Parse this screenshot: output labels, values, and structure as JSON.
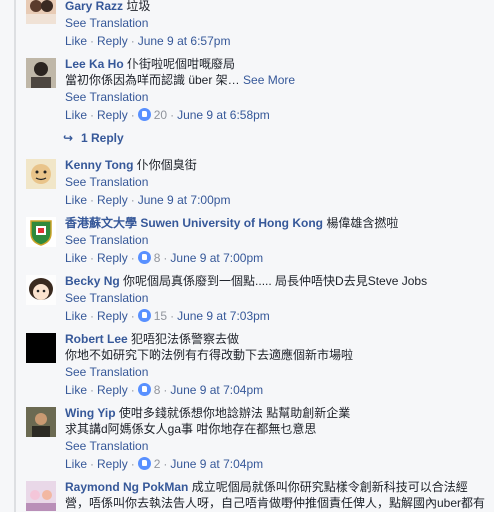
{
  "comments": [
    {
      "name": "Gary Razz",
      "text": "垃圾",
      "see_translation": "See Translation",
      "like": "Like",
      "reply": "Reply",
      "time": "June 9 at 6:57pm"
    },
    {
      "name": "Lee Ka Ho",
      "text": "仆街啦呢個咁嘅廢局",
      "text2": "當初你係因為咩而認識 über 架…",
      "see_more": "See More",
      "see_translation": "See Translation",
      "like": "Like",
      "reply": "Reply",
      "likes": "20",
      "time": "June 9 at 6:58pm"
    },
    {
      "name": "Kenny Tong",
      "text": "仆你個臭街",
      "see_translation": "See Translation",
      "like": "Like",
      "reply": "Reply",
      "time": "June 9 at 7:00pm"
    },
    {
      "name": "香港蘇文大學 Suwen University of Hong Kong",
      "text": "楊偉雄含撚啦",
      "see_translation": "See Translation",
      "like": "Like",
      "reply": "Reply",
      "likes": "8",
      "time": "June 9 at 7:00pm"
    },
    {
      "name": "Becky Ng",
      "text": "你呢個局真係廢到一個點..... 局長仲唔快D去見Steve Jobs",
      "see_translation": "See Translation",
      "like": "Like",
      "reply": "Reply",
      "likes": "15",
      "time": "June 9 at 7:03pm"
    },
    {
      "name": "Robert Lee",
      "text": "犯唔犯法係警察去做",
      "text2": "你地不如研究下啲法例有冇得改動下去適應個新市場啦",
      "see_translation": "See Translation",
      "like": "Like",
      "reply": "Reply",
      "likes": "8",
      "time": "June 9 at 7:04pm"
    },
    {
      "name": "Wing Yip",
      "text": "使咁多錢就係想你地諗辦法 點幫助創新企業",
      "text2": "求其講d阿媽係女人ga事 咁你地存在都無乜意思",
      "see_translation": "See Translation",
      "like": "Like",
      "reply": "Reply",
      "likes": "2",
      "time": "June 9 at 7:04pm"
    },
    {
      "name": "Raymond Ng PokMan",
      "text": "成立呢個局就係叫你研究點樣令創新科技可以合法經",
      "text2": "營，唔係叫你去執法告人呀，自己唔肯做嘢仲推個責任俾人，點解國內uber都有"
    }
  ],
  "replies_link": "1 Reply",
  "colors": {
    "link": "#365899",
    "meta": "#90949c",
    "like_badge": "#5890ff",
    "background": "#f6f7f9"
  }
}
